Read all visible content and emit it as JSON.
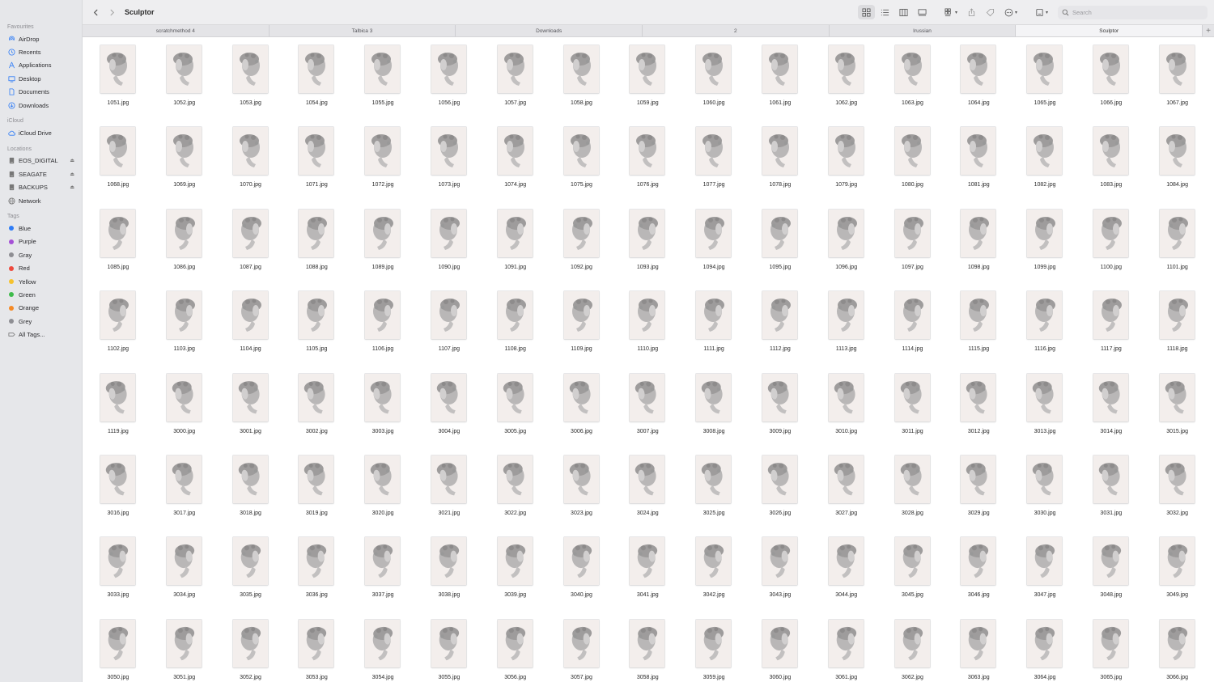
{
  "window": {
    "title": "Sculptor"
  },
  "toolbar": {
    "back_icon": "chevron-left-icon",
    "forward_icon": "chevron-right-icon",
    "view_icons": [
      "grid-view-icon",
      "list-view-icon",
      "column-view-icon",
      "gallery-view-icon"
    ],
    "search_placeholder": "Search"
  },
  "sidebar": {
    "favourites_title": "Favourites",
    "favourites": [
      {
        "label": "AirDrop",
        "icon": "airdrop-icon"
      },
      {
        "label": "Recents",
        "icon": "clock-icon"
      },
      {
        "label": "Applications",
        "icon": "applications-icon"
      },
      {
        "label": "Desktop",
        "icon": "desktop-icon"
      },
      {
        "label": "Documents",
        "icon": "document-icon"
      },
      {
        "label": "Downloads",
        "icon": "download-icon"
      }
    ],
    "icloud_title": "iCloud",
    "icloud": [
      {
        "label": "iCloud Drive",
        "icon": "cloud-icon"
      }
    ],
    "locations_title": "Locations",
    "locations": [
      {
        "label": "EOS_DIGITAL",
        "icon": "drive-icon",
        "eject": true
      },
      {
        "label": "SEAGATE",
        "icon": "drive-icon",
        "eject": true
      },
      {
        "label": "BACKUPS",
        "icon": "drive-icon",
        "eject": true
      },
      {
        "label": "Network",
        "icon": "network-icon",
        "eject": false
      }
    ],
    "tags_title": "Tags",
    "tags": [
      {
        "label": "Blue",
        "color": "#2f7cf6"
      },
      {
        "label": "Purple",
        "color": "#a550d6"
      },
      {
        "label": "Gray",
        "color": "#8e8e93"
      },
      {
        "label": "Red",
        "color": "#ee4a3e"
      },
      {
        "label": "Yellow",
        "color": "#f5c22e"
      },
      {
        "label": "Green",
        "color": "#3fbb4c"
      },
      {
        "label": "Orange",
        "color": "#f58a26"
      },
      {
        "label": "Grey",
        "color": "#8e8e93"
      }
    ],
    "all_tags_label": "All Tags..."
  },
  "tabs": [
    {
      "label": "scratchmethod 4",
      "active": false
    },
    {
      "label": "Talbica 3",
      "active": false
    },
    {
      "label": "Downloads",
      "active": false
    },
    {
      "label": "2",
      "active": false
    },
    {
      "label": "Irussian",
      "active": false
    },
    {
      "label": "Sculptor",
      "active": true
    }
  ],
  "files": [
    "1051.jpg",
    "1052.jpg",
    "1053.jpg",
    "1054.jpg",
    "1055.jpg",
    "1056.jpg",
    "1057.jpg",
    "1058.jpg",
    "1059.jpg",
    "1060.jpg",
    "1061.jpg",
    "1062.jpg",
    "1063.jpg",
    "1064.jpg",
    "1065.jpg",
    "1066.jpg",
    "1067.jpg",
    "1068.jpg",
    "1069.jpg",
    "1070.jpg",
    "1071.jpg",
    "1072.jpg",
    "1073.jpg",
    "1074.jpg",
    "1075.jpg",
    "1076.jpg",
    "1077.jpg",
    "1078.jpg",
    "1079.jpg",
    "1080.jpg",
    "1081.jpg",
    "1082.jpg",
    "1083.jpg",
    "1084.jpg",
    "1085.jpg",
    "1086.jpg",
    "1087.jpg",
    "1088.jpg",
    "1089.jpg",
    "1090.jpg",
    "1091.jpg",
    "1092.jpg",
    "1093.jpg",
    "1094.jpg",
    "1095.jpg",
    "1096.jpg",
    "1097.jpg",
    "1098.jpg",
    "1099.jpg",
    "1100.jpg",
    "1101.jpg",
    "1102.jpg",
    "1103.jpg",
    "1104.jpg",
    "1105.jpg",
    "1106.jpg",
    "1107.jpg",
    "1108.jpg",
    "1109.jpg",
    "1110.jpg",
    "1111.jpg",
    "1112.jpg",
    "1113.jpg",
    "1114.jpg",
    "1115.jpg",
    "1116.jpg",
    "1117.jpg",
    "1118.jpg",
    "1119.jpg",
    "3000.jpg",
    "3001.jpg",
    "3002.jpg",
    "3003.jpg",
    "3004.jpg",
    "3005.jpg",
    "3006.jpg",
    "3007.jpg",
    "3008.jpg",
    "3009.jpg",
    "3010.jpg",
    "3011.jpg",
    "3012.jpg",
    "3013.jpg",
    "3014.jpg",
    "3015.jpg",
    "3016.jpg",
    "3017.jpg",
    "3018.jpg",
    "3019.jpg",
    "3020.jpg",
    "3021.jpg",
    "3022.jpg",
    "3023.jpg",
    "3024.jpg",
    "3025.jpg",
    "3026.jpg",
    "3027.jpg",
    "3028.jpg",
    "3029.jpg",
    "3030.jpg",
    "3031.jpg",
    "3032.jpg",
    "3033.jpg",
    "3034.jpg",
    "3035.jpg",
    "3036.jpg",
    "3037.jpg",
    "3038.jpg",
    "3039.jpg",
    "3040.jpg",
    "3041.jpg",
    "3042.jpg",
    "3043.jpg",
    "3044.jpg",
    "3045.jpg",
    "3046.jpg",
    "3047.jpg",
    "3048.jpg",
    "3049.jpg",
    "3050.jpg",
    "3051.jpg",
    "3052.jpg",
    "3053.jpg",
    "3054.jpg",
    "3055.jpg",
    "3056.jpg",
    "3057.jpg",
    "3058.jpg",
    "3059.jpg",
    "3060.jpg",
    "3061.jpg",
    "3062.jpg",
    "3063.jpg",
    "3064.jpg",
    "3065.jpg",
    "3066.jpg"
  ],
  "colors": {
    "accent": "#2f7cf6",
    "sidebar_bg": "#e6e7ea",
    "thumb_bg": "#f3eeec"
  }
}
